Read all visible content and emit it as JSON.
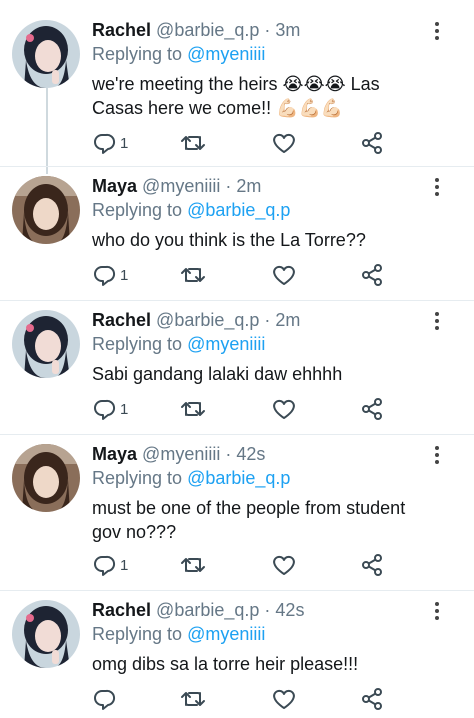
{
  "tweets": [
    {
      "name": "Rachel",
      "handle": "@barbie_q.p",
      "time": "3m",
      "replying_prefix": "Replying to ",
      "replying_to": "@myeniiii",
      "text": "we're meeting the heirs",
      "emoji_1": "😭😭😭",
      "text_2": " Las Casas here we come!!",
      "emoji_2": "💪🏻💪🏻💪🏻",
      "reply_count": "1",
      "avatar": "rachel"
    },
    {
      "name": "Maya",
      "handle": "@myeniiii",
      "time": "2m",
      "replying_prefix": "Replying to ",
      "replying_to": "@barbie_q.p",
      "text": "who do you think is the La Torre??",
      "reply_count": "1",
      "avatar": "maya"
    },
    {
      "name": "Rachel",
      "handle": "@barbie_q.p",
      "time": "2m",
      "replying_prefix": "Replying to ",
      "replying_to": "@myeniiii",
      "text": "Sabi gandang lalaki daw ehhhh",
      "reply_count": "1",
      "avatar": "rachel"
    },
    {
      "name": "Maya",
      "handle": "@myeniiii",
      "time": "42s",
      "replying_prefix": "Replying to ",
      "replying_to": "@barbie_q.p",
      "text": "must be one of the people from student gov no???",
      "reply_count": "1",
      "avatar": "maya"
    },
    {
      "name": "Rachel",
      "handle": "@barbie_q.p",
      "time": "42s",
      "replying_prefix": "Replying to ",
      "replying_to": "@myeniiii",
      "text": "omg dibs sa la torre heir please!!!",
      "reply_count": "",
      "avatar": "rachel"
    }
  ],
  "separator": "·",
  "icons": {
    "reply": "reply-icon",
    "retweet": "retweet-icon",
    "like": "heart-icon",
    "share": "share-icon",
    "more": "more-vertical-icon"
  },
  "colors": {
    "name": "#14171a",
    "meta": "#657786",
    "mention": "#1da1f2",
    "icon": "#3b4a54",
    "thread_line": "#cfd9de"
  }
}
